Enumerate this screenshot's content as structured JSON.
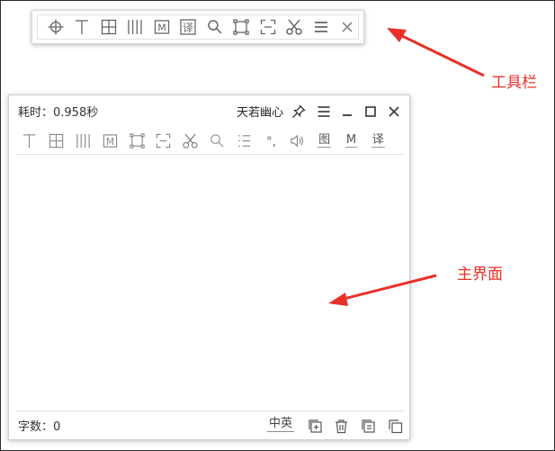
{
  "toolbar": {
    "buttons": [
      {
        "name": "crosshair-icon"
      },
      {
        "name": "text-cursor-icon"
      },
      {
        "name": "table-icon"
      },
      {
        "name": "columns-icon"
      },
      {
        "name": "m-box-icon",
        "glyph": "M"
      },
      {
        "name": "translate-icon",
        "glyph": "译"
      },
      {
        "name": "search-icon"
      },
      {
        "name": "screenshot-rect-icon"
      },
      {
        "name": "capture-region-icon"
      },
      {
        "name": "scissors-icon"
      },
      {
        "name": "menu-icon"
      },
      {
        "name": "close-icon"
      }
    ]
  },
  "window": {
    "elapsed": "耗时：0.958秒",
    "author": "天若幽心",
    "word_count": "字数：0",
    "lang_toggle": "中英",
    "icon_row": [
      {
        "name": "text-cursor-icon"
      },
      {
        "name": "table-icon"
      },
      {
        "name": "columns-icon"
      },
      {
        "name": "m-box-icon",
        "glyph": "M"
      },
      {
        "name": "screenshot-rect-icon"
      },
      {
        "name": "capture-region-icon"
      },
      {
        "name": "scissors-icon"
      },
      {
        "name": "search-icon"
      },
      {
        "name": "list-icon"
      },
      {
        "name": "degree-comma-icon",
        "glyph": "°,"
      },
      {
        "name": "speaker-icon"
      }
    ],
    "text_links": [
      {
        "name": "image-link",
        "label": "图"
      },
      {
        "name": "m-link",
        "label": "M"
      },
      {
        "name": "translate-link",
        "label": "译"
      }
    ]
  },
  "annotations": {
    "toolbar_label": "工具栏",
    "main_label": "主界面",
    "color": "#e8302b"
  }
}
